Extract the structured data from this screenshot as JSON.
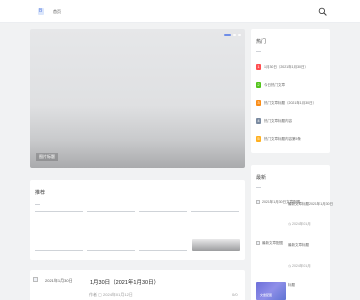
{
  "header": {
    "logo_text": "B",
    "nav_label": "首页",
    "accent_color": "#6f8ee8"
  },
  "hero": {
    "caption": "图片标题"
  },
  "recommend": {
    "title": "推荐"
  },
  "post": {
    "image_alt": "2021年1月30日",
    "title": "1月30日（2021年1月30日）",
    "author": "作者",
    "date": "2024年01月12日",
    "count": "0/0"
  },
  "hot": {
    "title": "热门",
    "items": [
      {
        "rank": "1",
        "text": "1月30日（2021年1月30日）",
        "color": "#ff4d4f"
      },
      {
        "rank": "2",
        "text": "今日热门文章",
        "color": "#52c41a"
      },
      {
        "rank": "3",
        "text": "热门文章标题（2021年1月30日）",
        "color": "#fa8c16"
      },
      {
        "rank": "4",
        "text": "热门文章标题内容",
        "color": "#7a8aa0"
      },
      {
        "rank": "5",
        "text": "热门文章标题内容第5条",
        "color": "#ffb020"
      }
    ]
  },
  "latest": {
    "title": "最新",
    "items": [
      {
        "alt": "2021年1月30日文章配图",
        "text": "最新文章标题2021年1月30日",
        "date": "2024年01月"
      },
      {
        "alt": "最新文章配图",
        "text": "最新文章标题",
        "date": "2024年01月"
      }
    ],
    "thumb_caption": "文章配图",
    "third_title": "标题"
  }
}
